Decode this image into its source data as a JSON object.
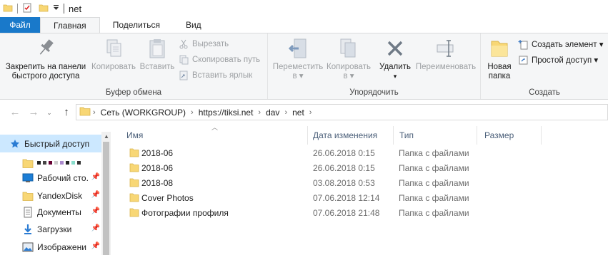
{
  "window": {
    "title": "net"
  },
  "tabs": {
    "file": "Файл",
    "home": "Главная",
    "share": "Поделиться",
    "view": "Вид"
  },
  "ribbon": {
    "clipboard": {
      "label": "Буфер обмена",
      "pin_line1": "Закрепить на панели",
      "pin_line2": "быстрого доступа",
      "copy": "Копировать",
      "paste": "Вставить",
      "cut": "Вырезать",
      "copy_path": "Скопировать путь",
      "paste_shortcut": "Вставить ярлык"
    },
    "organize": {
      "label": "Упорядочить",
      "move_line1": "Переместить",
      "move_line2": "в ▾",
      "copy_line1": "Копировать",
      "copy_line2": "в ▾",
      "delete": "Удалить",
      "delete_arrow": "▾",
      "rename": "Переименовать"
    },
    "create": {
      "label": "Создать",
      "new_folder_line1": "Новая",
      "new_folder_line2": "папка",
      "new_item": "Создать элемент ▾",
      "easy_access": "Простой доступ ▾"
    }
  },
  "address": {
    "crumbs": [
      "Сеть (WORKGROUP)",
      "https://tiksi.net",
      "dav",
      "net"
    ]
  },
  "nav": {
    "quick_access": "Быстрый доступ",
    "items": [
      {
        "label": "Рабочий сто.",
        "icon": "desktop-icon"
      },
      {
        "label": "YandexDisk",
        "icon": "folder-icon"
      },
      {
        "label": "Документы",
        "icon": "documents-icon"
      },
      {
        "label": "Загрузки",
        "icon": "downloads-icon"
      },
      {
        "label": "Изображени",
        "icon": "pictures-icon"
      }
    ]
  },
  "columns": {
    "name": "Имя",
    "date": "Дата изменения",
    "type": "Тип",
    "size": "Размер"
  },
  "files": [
    {
      "name": "2018-06",
      "date": "26.06.2018 0:15",
      "type": "Папка с файлами"
    },
    {
      "name": "2018-06",
      "date": "26.06.2018 0:15",
      "type": "Папка с файлами"
    },
    {
      "name": "2018-08",
      "date": "03.08.2018 0:53",
      "type": "Папка с файлами"
    },
    {
      "name": "Cover Photos",
      "date": "07.06.2018 12:14",
      "type": "Папка с файлами"
    },
    {
      "name": "Фотографии профиля",
      "date": "07.06.2018 21:48",
      "type": "Папка с файлами"
    }
  ],
  "colors": {
    "file_tab": "#1979ca",
    "selection": "#cce8ff",
    "folder": "#f8d775",
    "header_text": "#4c607a"
  }
}
